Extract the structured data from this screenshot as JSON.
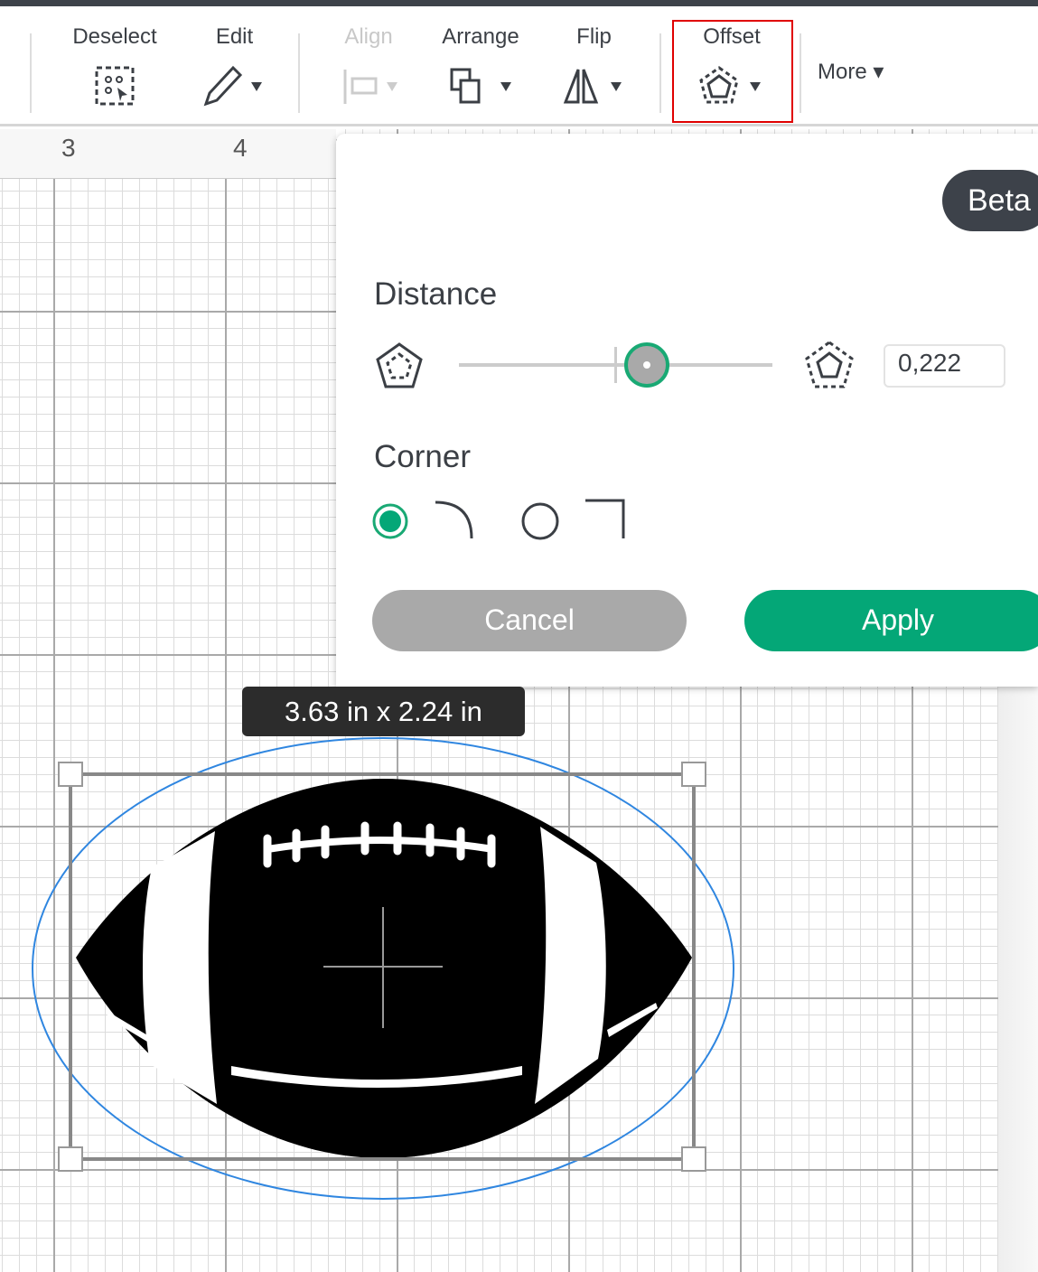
{
  "toolbar": {
    "deselect": "Deselect",
    "edit": "Edit",
    "align": "Align",
    "arrange": "Arrange",
    "flip": "Flip",
    "offset": "Offset",
    "more": "More"
  },
  "ruler": {
    "marks": [
      "3",
      "4"
    ]
  },
  "offset_panel": {
    "badge": "Beta",
    "distance_label": "Distance",
    "distance_value": "0,222",
    "slider_fraction": 0.6,
    "corner_label": "Corner",
    "corner_options": [
      {
        "name": "rounded",
        "selected": true
      },
      {
        "name": "square",
        "selected": false
      }
    ],
    "cancel": "Cancel",
    "apply": "Apply"
  },
  "selection": {
    "dimensions": "3.63  in x 2.24  in"
  },
  "colors": {
    "accent": "#04a777",
    "highlight": "#e00000",
    "offset_outline": "#2f86e0",
    "dark": "#3d424a"
  }
}
